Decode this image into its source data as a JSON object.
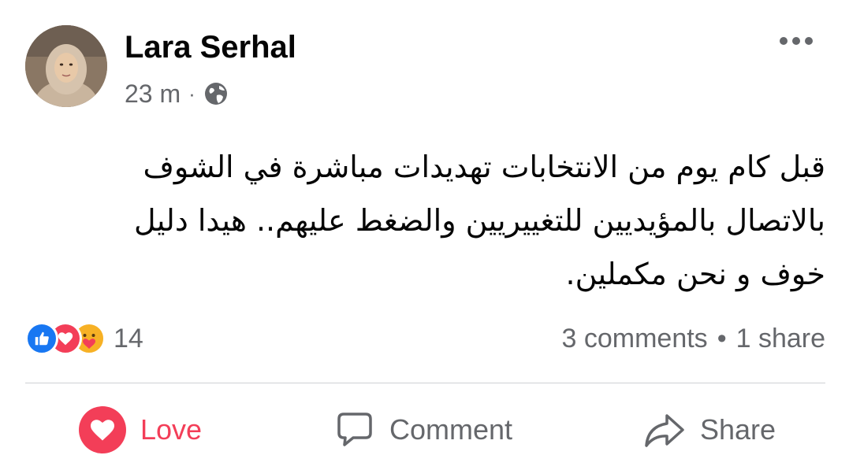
{
  "post": {
    "author": "Lara Serhal",
    "timestamp": "23 m",
    "meta_separator": "·",
    "privacy_icon": "globe-icon",
    "more_icon": "more-options-icon",
    "text": "قبل كام يوم من الانتخابات تهديدات مباشرة في الشوف بالاتصال بالمؤيديين للتغييريين والضغط عليهم.. هيدا دليل خوف و نحن مكملين."
  },
  "reactions": {
    "types": [
      "like-icon",
      "love-icon",
      "care-icon"
    ],
    "count": "14"
  },
  "engagement": {
    "comments": "3 comments",
    "separator": "•",
    "shares": "1 share"
  },
  "actions": {
    "love_label": "Love",
    "comment_label": "Comment",
    "share_label": "Share"
  },
  "colors": {
    "love": "#f33e58",
    "like": "#1877f2",
    "care": "#f7b125",
    "secondary_text": "#65676b",
    "primary_text": "#050505",
    "divider": "#ced0d4"
  }
}
